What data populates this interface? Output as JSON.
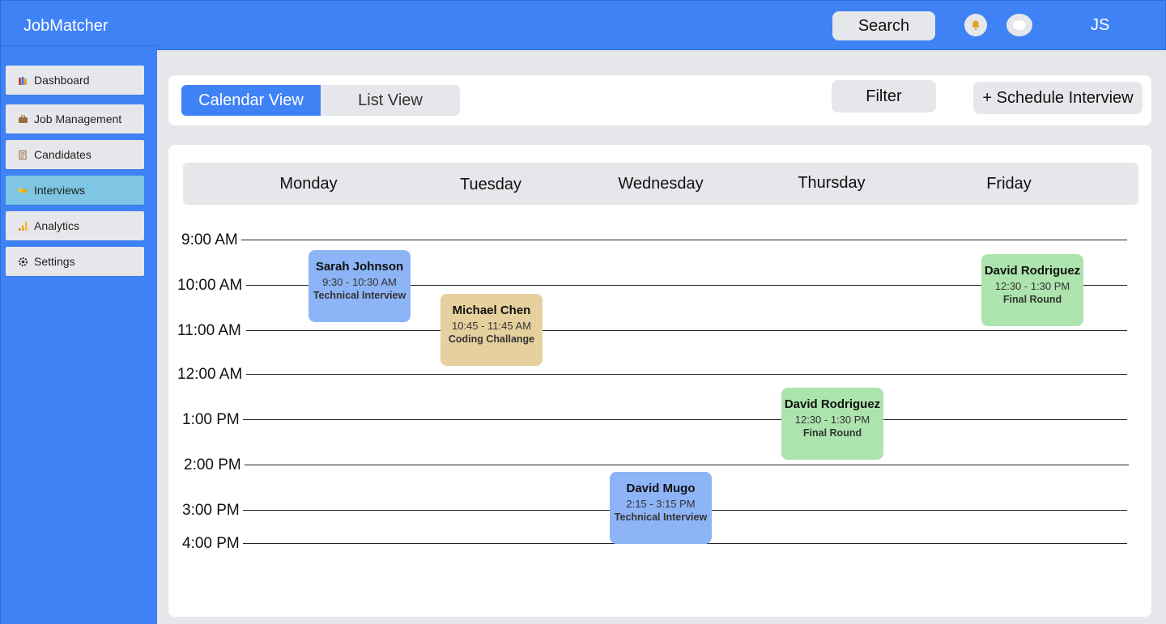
{
  "app": {
    "title": "JobMatcher",
    "user_initials": "JS"
  },
  "header": {
    "search_label": "Search",
    "icons": [
      "bell-icon",
      "chat-icon"
    ]
  },
  "sidebar": {
    "items": [
      {
        "label": "Dashboard",
        "icon": "books-icon",
        "active": false
      },
      {
        "label": "Job Management",
        "icon": "briefcase-icon",
        "active": false
      },
      {
        "label": "Candidates",
        "icon": "memo-icon",
        "active": false
      },
      {
        "label": "Interviews",
        "icon": "handshake-icon",
        "active": true
      },
      {
        "label": "Analytics",
        "icon": "bar-chart-icon",
        "active": false
      },
      {
        "label": "Settings",
        "icon": "gear-icon",
        "active": false
      }
    ]
  },
  "toolbar": {
    "view_tabs": [
      "Calendar View",
      "List View"
    ],
    "selected_view": "Calendar View",
    "filter_label": "Filter",
    "schedule_label": "+ Schedule Interview"
  },
  "calendar": {
    "days": [
      "Monday",
      "Tuesday",
      "Wednesday",
      "Thursday",
      "Friday"
    ],
    "times": [
      "9:00 AM",
      "10:00 AM",
      "11:00 AM",
      "12:00 AM",
      "1:00 PM",
      "2:00 PM",
      "3:00 PM",
      "4:00 PM"
    ],
    "events": [
      {
        "name": "Sarah Johnson",
        "time": "9:30 - 10:30 AM",
        "type": "Technical Interview",
        "day": "Monday"
      },
      {
        "name": "Michael Chen",
        "time": "10:45 - 11:45 AM",
        "type": "Coding Challange",
        "day": "Tuesday"
      },
      {
        "name": "David Rodriguez",
        "time": "12:30 - 1:30 PM",
        "type": "Final Round",
        "day": "Friday"
      },
      {
        "name": "David Rodriguez",
        "time": "12:30 - 1:30 PM",
        "type": "Final Round",
        "day": "Thursday"
      },
      {
        "name": "David Mugo",
        "time": "2:15 - 3:15 PM",
        "type": "Technical Interview",
        "day": "Wednesday"
      }
    ]
  },
  "colors": {
    "primary": "#3f82f6",
    "active_nav": "#7ec6e4",
    "event_blue": "#8db4f6",
    "event_tan": "#e6d09e",
    "event_green": "#ade4ad"
  }
}
